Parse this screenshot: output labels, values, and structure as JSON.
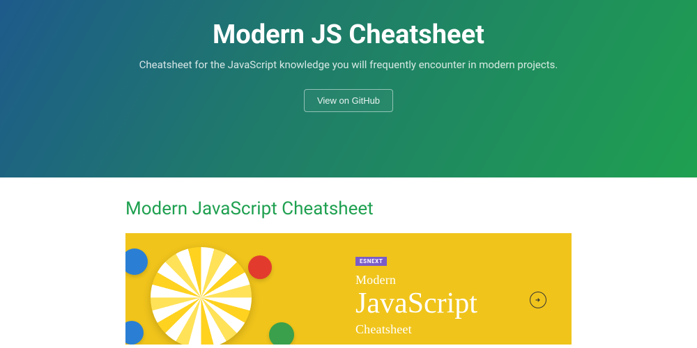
{
  "hero": {
    "title": "Modern JS Cheatsheet",
    "subtitle": "Cheatsheet for the JavaScript knowledge you will frequently encounter in modern projects.",
    "github_button": "View on GitHub"
  },
  "section": {
    "heading": "Modern JavaScript Cheatsheet"
  },
  "banner": {
    "tag": "ESNEXT",
    "line1": "Modern",
    "line2": "JavaScript",
    "line3": "Cheatsheet"
  }
}
